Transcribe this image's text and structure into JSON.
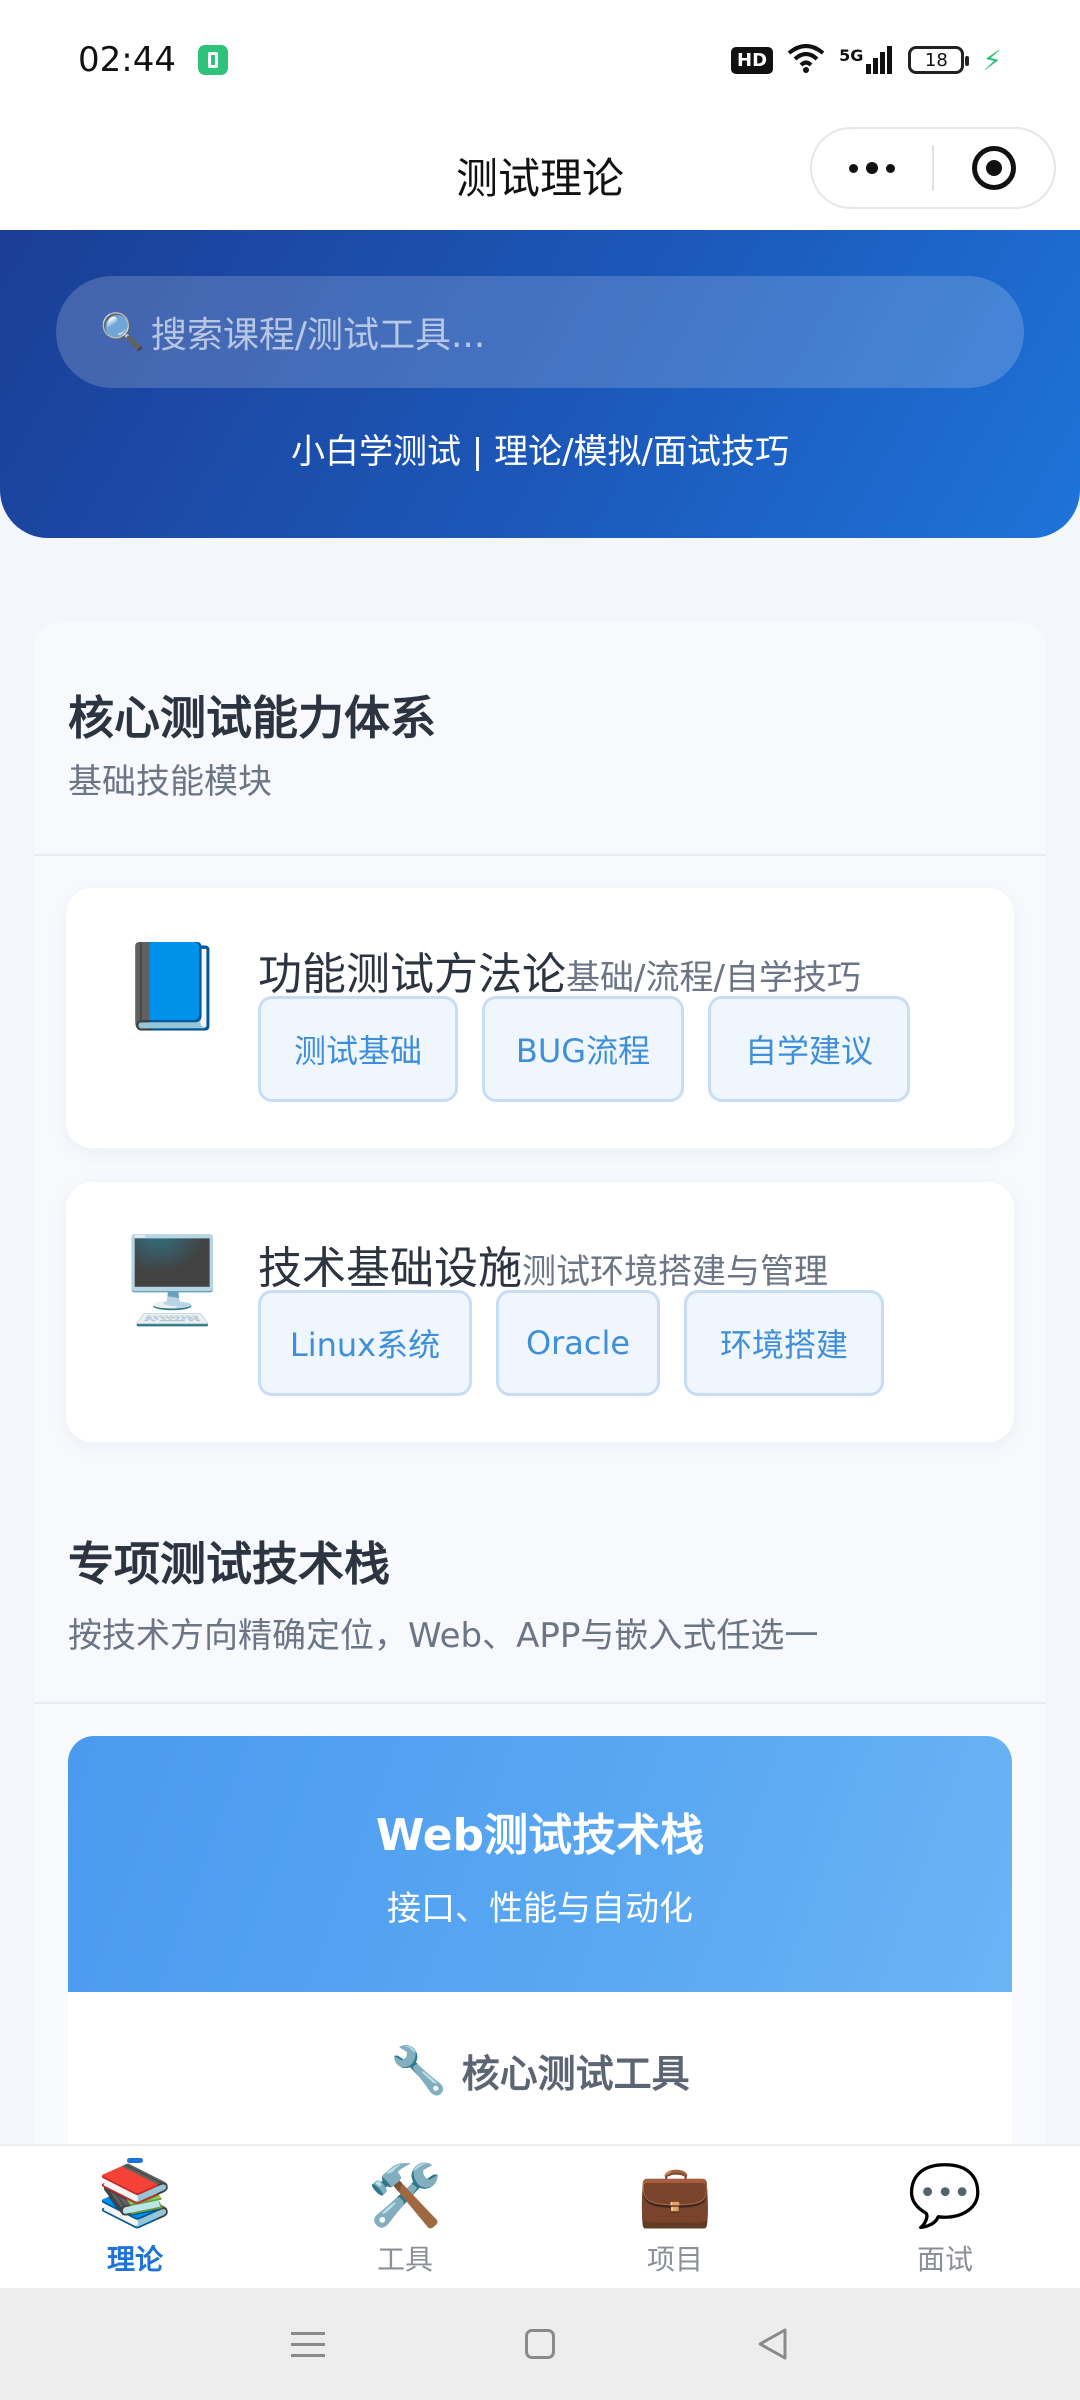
{
  "status_bar": {
    "time": "02:44",
    "hd": "HD",
    "network": "5G",
    "battery": "18"
  },
  "nav": {
    "title": "测试理论"
  },
  "hero": {
    "search_placeholder": "搜索课程/测试工具...",
    "subtitle": "小白学测试 | 理论/模拟/面试技巧"
  },
  "sections": {
    "core": {
      "title": "核心测试能力体系",
      "subtitle": "基础技能模块",
      "modules": [
        {
          "icon": "blue-book-icon",
          "emoji": "📘",
          "name": "功能测试方法论",
          "desc": "基础/流程/自学技巧",
          "chips": [
            "测试基础",
            "BUG流程",
            "自学建议"
          ]
        },
        {
          "icon": "computer-icon",
          "emoji": "🖥️",
          "name": "技术基础设施",
          "desc": "测试环境搭建与管理",
          "chips": [
            "Linux系统",
            "Oracle",
            "环境搭建"
          ]
        }
      ]
    },
    "special": {
      "title": "专项测试技术栈",
      "subtitle": "按技术方向精确定位，Web、APP与嵌入式任选一",
      "web_card": {
        "title": "Web测试技术栈",
        "subtitle": "接口、性能与自动化",
        "tools_icon": "wrench-icon",
        "tools_label": "核心测试工具"
      }
    }
  },
  "tab_bar": {
    "tabs": [
      {
        "label": "理论",
        "icon": "books-icon",
        "active": true
      },
      {
        "label": "工具",
        "icon": "tools-icon",
        "active": false
      },
      {
        "label": "项目",
        "icon": "briefcase-icon",
        "active": false
      },
      {
        "label": "面试",
        "icon": "speech-bubble-icon",
        "active": false
      }
    ]
  },
  "colors": {
    "accent": "#1e73d9",
    "hero_start": "#1b3e96",
    "hero_end": "#1e73d9",
    "chip_text": "#3f8fd8",
    "web_card": "#4a9af0"
  }
}
